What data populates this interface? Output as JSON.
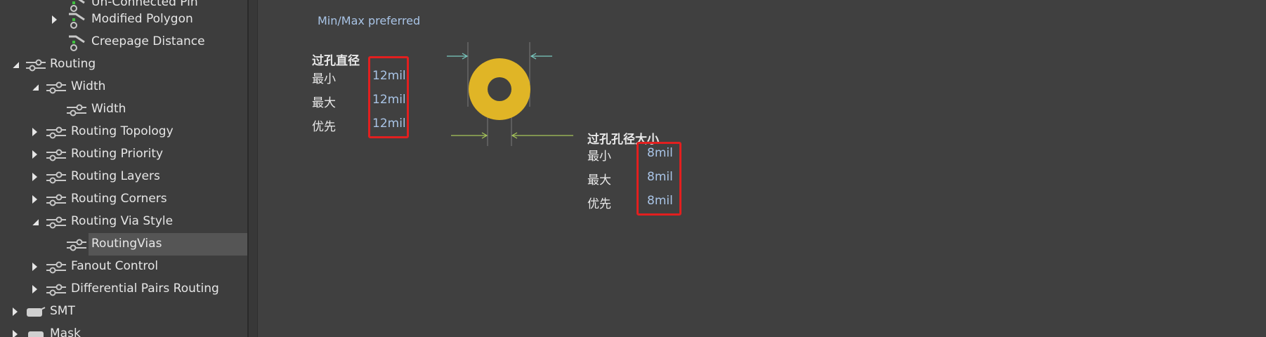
{
  "tree": {
    "items": [
      {
        "label": "Un-Connected Pin",
        "expanded": false,
        "has_arrow": false,
        "icon": "clearance-rule-icon"
      },
      {
        "label": "Modified Polygon",
        "expanded": false,
        "has_arrow": true,
        "icon": "clearance-rule-icon"
      },
      {
        "label": "Creepage Distance",
        "expanded": false,
        "has_arrow": false,
        "icon": "clearance-rule-icon"
      },
      {
        "label": "Routing",
        "expanded": true,
        "has_arrow": true,
        "icon": "routing-rule-icon"
      },
      {
        "label": "Width",
        "expanded": true,
        "has_arrow": true,
        "icon": "routing-rule-icon"
      },
      {
        "label": "Width",
        "expanded": false,
        "has_arrow": false,
        "icon": "routing-rule-icon"
      },
      {
        "label": "Routing Topology",
        "expanded": false,
        "has_arrow": true,
        "icon": "routing-rule-icon"
      },
      {
        "label": "Routing Priority",
        "expanded": false,
        "has_arrow": true,
        "icon": "routing-rule-icon"
      },
      {
        "label": "Routing Layers",
        "expanded": false,
        "has_arrow": true,
        "icon": "routing-rule-icon"
      },
      {
        "label": "Routing Corners",
        "expanded": false,
        "has_arrow": true,
        "icon": "routing-rule-icon"
      },
      {
        "label": "Routing Via Style",
        "expanded": true,
        "has_arrow": true,
        "icon": "routing-rule-icon"
      },
      {
        "label": "RoutingVias",
        "expanded": false,
        "has_arrow": false,
        "icon": "routing-rule-icon",
        "selected": true
      },
      {
        "label": "Fanout Control",
        "expanded": false,
        "has_arrow": true,
        "icon": "routing-rule-icon"
      },
      {
        "label": "Differential Pairs Routing",
        "expanded": false,
        "has_arrow": true,
        "icon": "routing-rule-icon"
      },
      {
        "label": "SMT",
        "expanded": false,
        "has_arrow": true,
        "icon": "smt-rule-icon"
      },
      {
        "label": "Mask",
        "expanded": false,
        "has_arrow": true,
        "icon": "mask-rule-icon"
      }
    ]
  },
  "editor": {
    "mode_label": "Min/Max preferred",
    "via_diameter": {
      "title": "过孔直径",
      "rows": [
        {
          "label": "最小",
          "value": "12mil"
        },
        {
          "label": "最大",
          "value": "12mil"
        },
        {
          "label": "优先",
          "value": "12mil"
        }
      ]
    },
    "hole_size": {
      "title": "过孔孔径大小",
      "rows": [
        {
          "label": "最小",
          "value": "8mil"
        },
        {
          "label": "最大",
          "value": "8mil"
        },
        {
          "label": "优先",
          "value": "8mil"
        }
      ]
    }
  },
  "colors": {
    "panel_bg": "#3d3d3d",
    "main_bg": "#404040",
    "value_text": "#a9c4e6",
    "highlight_box": "#e21f1f",
    "via_pad": "#e0b526",
    "dim_arrow_cyan": "#79c9c0",
    "dim_arrow_green": "#a6c65a"
  }
}
